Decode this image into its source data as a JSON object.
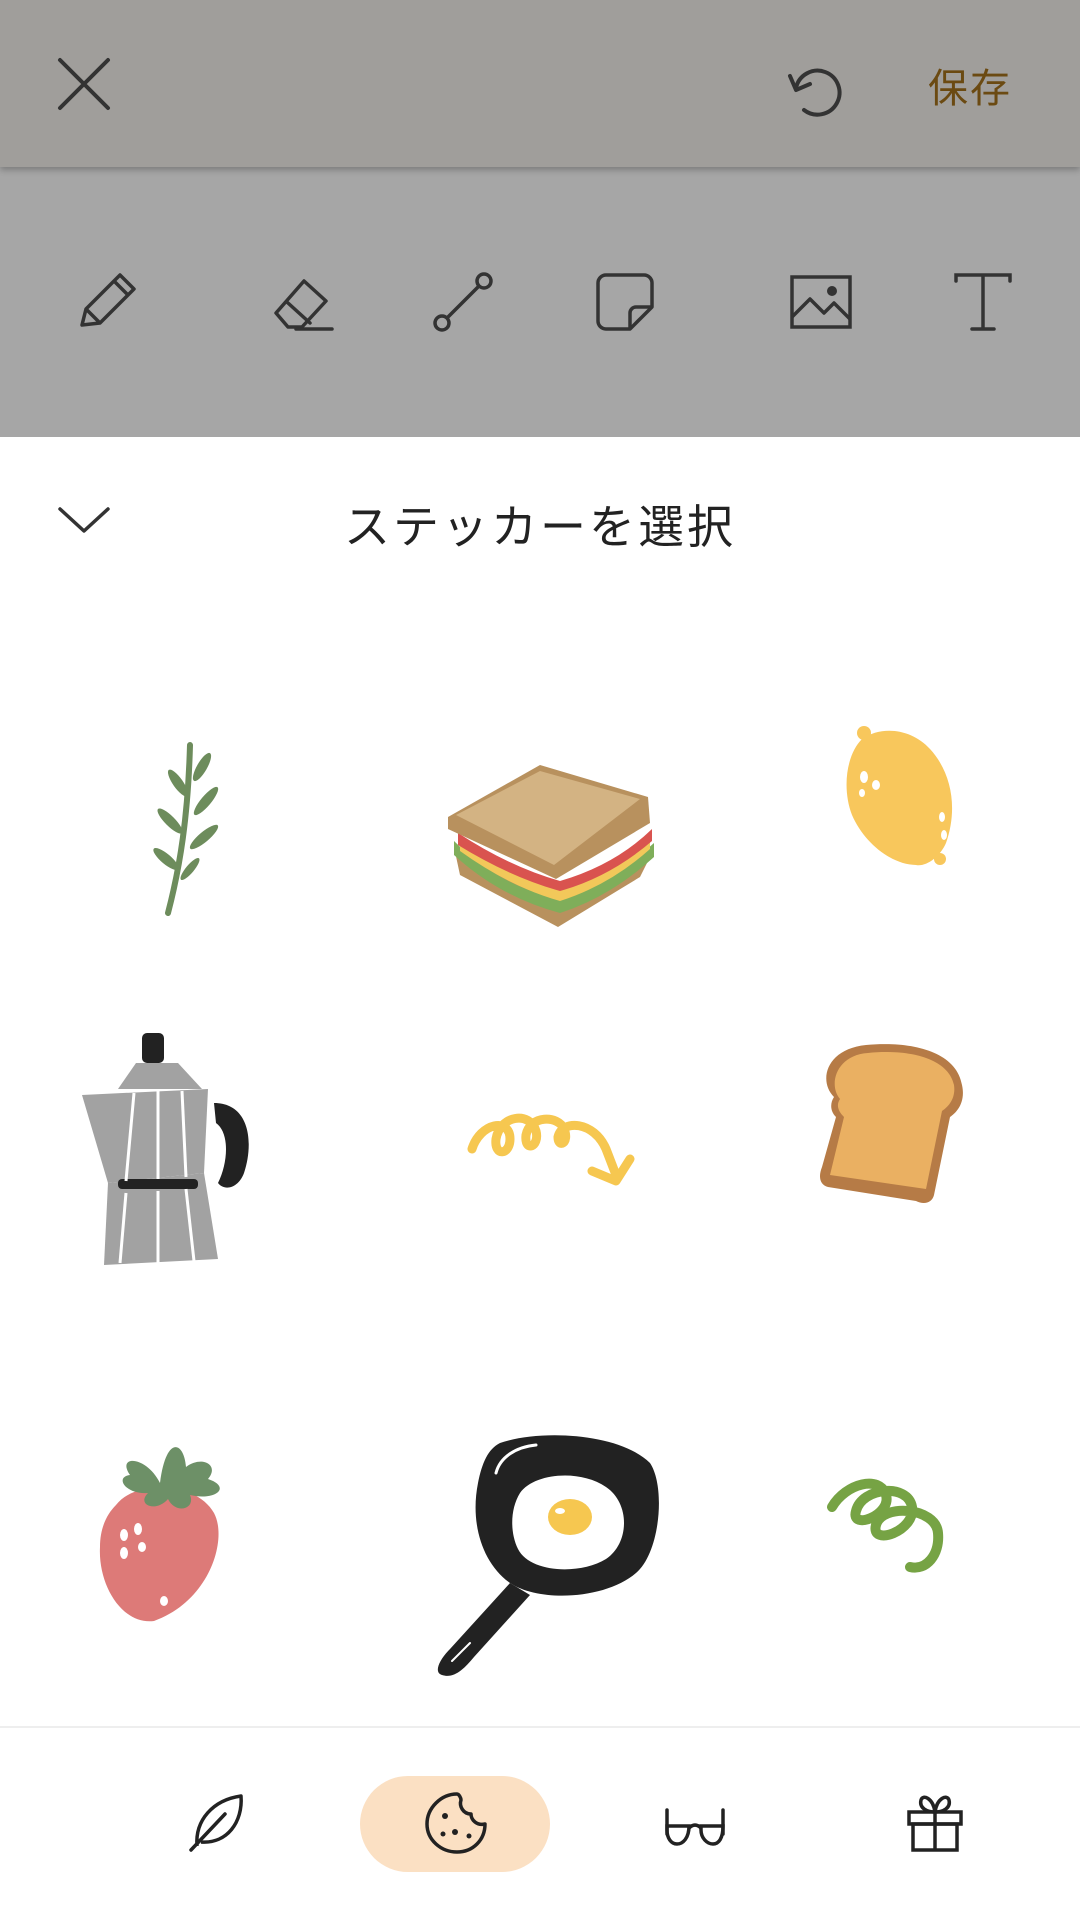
{
  "header": {
    "save_label": "保存",
    "icons": [
      "close-icon",
      "undo-icon"
    ]
  },
  "tools": [
    "pencil-icon",
    "eraser-icon",
    "line-icon",
    "sticker-note-icon",
    "image-icon",
    "text-icon"
  ],
  "sheet": {
    "title": "ステッカーを選択"
  },
  "stickers": [
    "rosemary-sprig",
    "sandwich",
    "lemon",
    "moka-pot",
    "yellow-squiggle-arrow",
    "toast-slice",
    "strawberry",
    "fried-egg-pan",
    "green-squiggle"
  ],
  "tabs": [
    {
      "icon": "leaf-icon",
      "active": false
    },
    {
      "icon": "cookie-icon",
      "active": true
    },
    {
      "icon": "glasses-icon",
      "active": false
    },
    {
      "icon": "gift-icon",
      "active": false
    }
  ],
  "colors": {
    "accent": "#6b4a12",
    "active_tab_bg": "#fbe0c3",
    "overlay_top": "#a09e9b",
    "overlay_tools": "#a6a6a6"
  }
}
